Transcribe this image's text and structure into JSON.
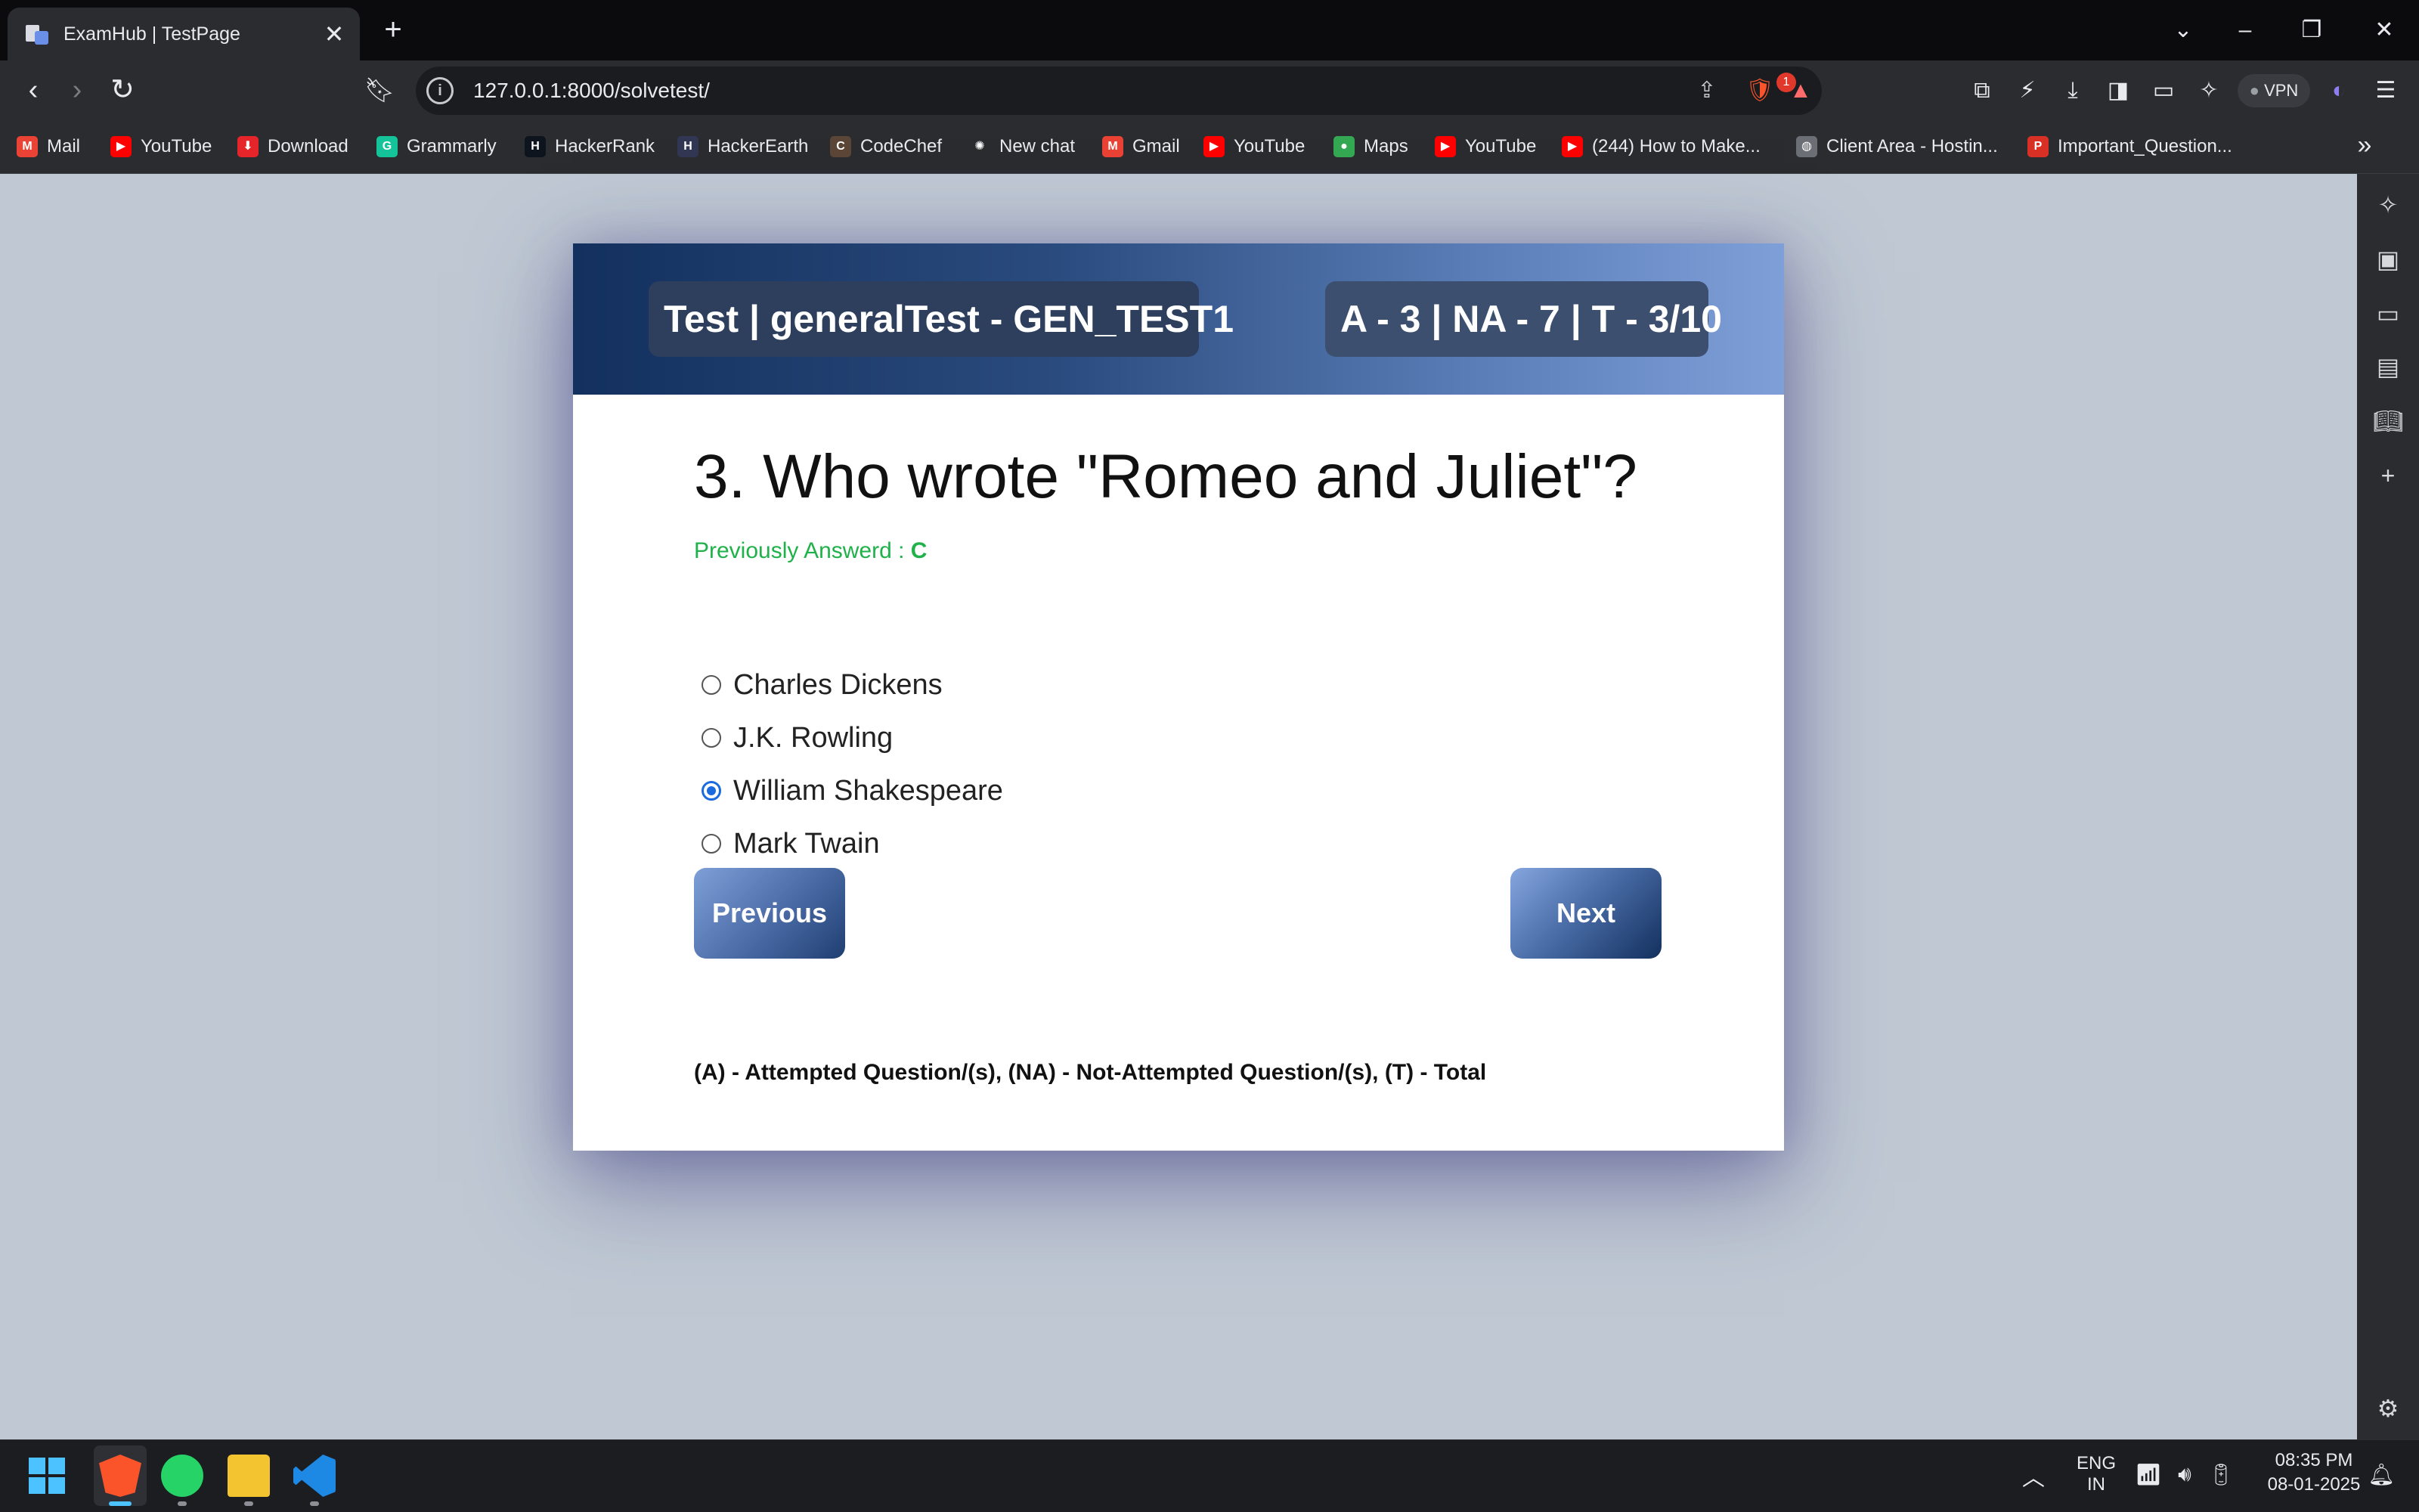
{
  "browser": {
    "tab_title": "ExamHub | TestPage",
    "url": "127.0.0.1:8000/solvetest/",
    "vpn_label": "VPN",
    "notification_count": "1",
    "bookmarks": [
      {
        "label": "Mail",
        "icon": "gmail-icon",
        "color": "#ea4335"
      },
      {
        "label": "YouTube",
        "icon": "youtube-icon",
        "color": "#ff0000"
      },
      {
        "label": "Download",
        "icon": "download-icon",
        "color": "#e5252a"
      },
      {
        "label": "Grammarly",
        "icon": "grammarly-icon",
        "color": "#15c39a"
      },
      {
        "label": "HackerRank",
        "icon": "hackerrank-icon",
        "color": "#0e141e"
      },
      {
        "label": "HackerEarth",
        "icon": "hackerearth-icon",
        "color": "#323754"
      },
      {
        "label": "CodeChef",
        "icon": "codechef-icon",
        "color": "#5b4638"
      },
      {
        "label": "New chat",
        "icon": "openai-icon",
        "color": "#2b2c30"
      },
      {
        "label": "Gmail",
        "icon": "gmail-icon",
        "color": "#ea4335"
      },
      {
        "label": "YouTube",
        "icon": "youtube-icon",
        "color": "#ff0000"
      },
      {
        "label": "Maps",
        "icon": "maps-pin-icon",
        "color": "#34a853"
      },
      {
        "label": "YouTube",
        "icon": "youtube-icon",
        "color": "#ff0000"
      },
      {
        "label": "(244) How to Make...",
        "icon": "youtube-icon",
        "color": "#ff0000"
      },
      {
        "label": "Client Area - Hostin...",
        "icon": "globe-icon",
        "color": "#6b6e74"
      },
      {
        "label": "Important_Question...",
        "icon": "pdf-icon",
        "color": "#d93025"
      }
    ]
  },
  "exam": {
    "header_title": "Test | generalTest - GEN_TEST1",
    "header_stats": "A - 3 | NA - 7 | T - 3/10",
    "question": "3. Who wrote \"Romeo and Juliet\"?",
    "previous_answer_label": "Previously Answerd : ",
    "previous_answer_value": "C",
    "options": [
      {
        "label": "Charles Dickens",
        "checked": false
      },
      {
        "label": "J.K. Rowling",
        "checked": false
      },
      {
        "label": "William Shakespeare",
        "checked": true
      },
      {
        "label": "Mark Twain",
        "checked": false
      }
    ],
    "prev_button": "Previous",
    "next_button": "Next",
    "legend": "(A) - Attempted Question/(s), (NA) - Not-Attempted Question/(s), (T) - Total",
    "colors": {
      "accent_green": "#1fb14a",
      "header_dark": "#13305e",
      "header_light": "#7f9fd8",
      "radio_blue": "#1a6be0"
    }
  },
  "taskbar": {
    "lang_top": "ENG",
    "lang_bottom": "IN",
    "time": "08:35 PM",
    "date": "08-01-2025"
  }
}
